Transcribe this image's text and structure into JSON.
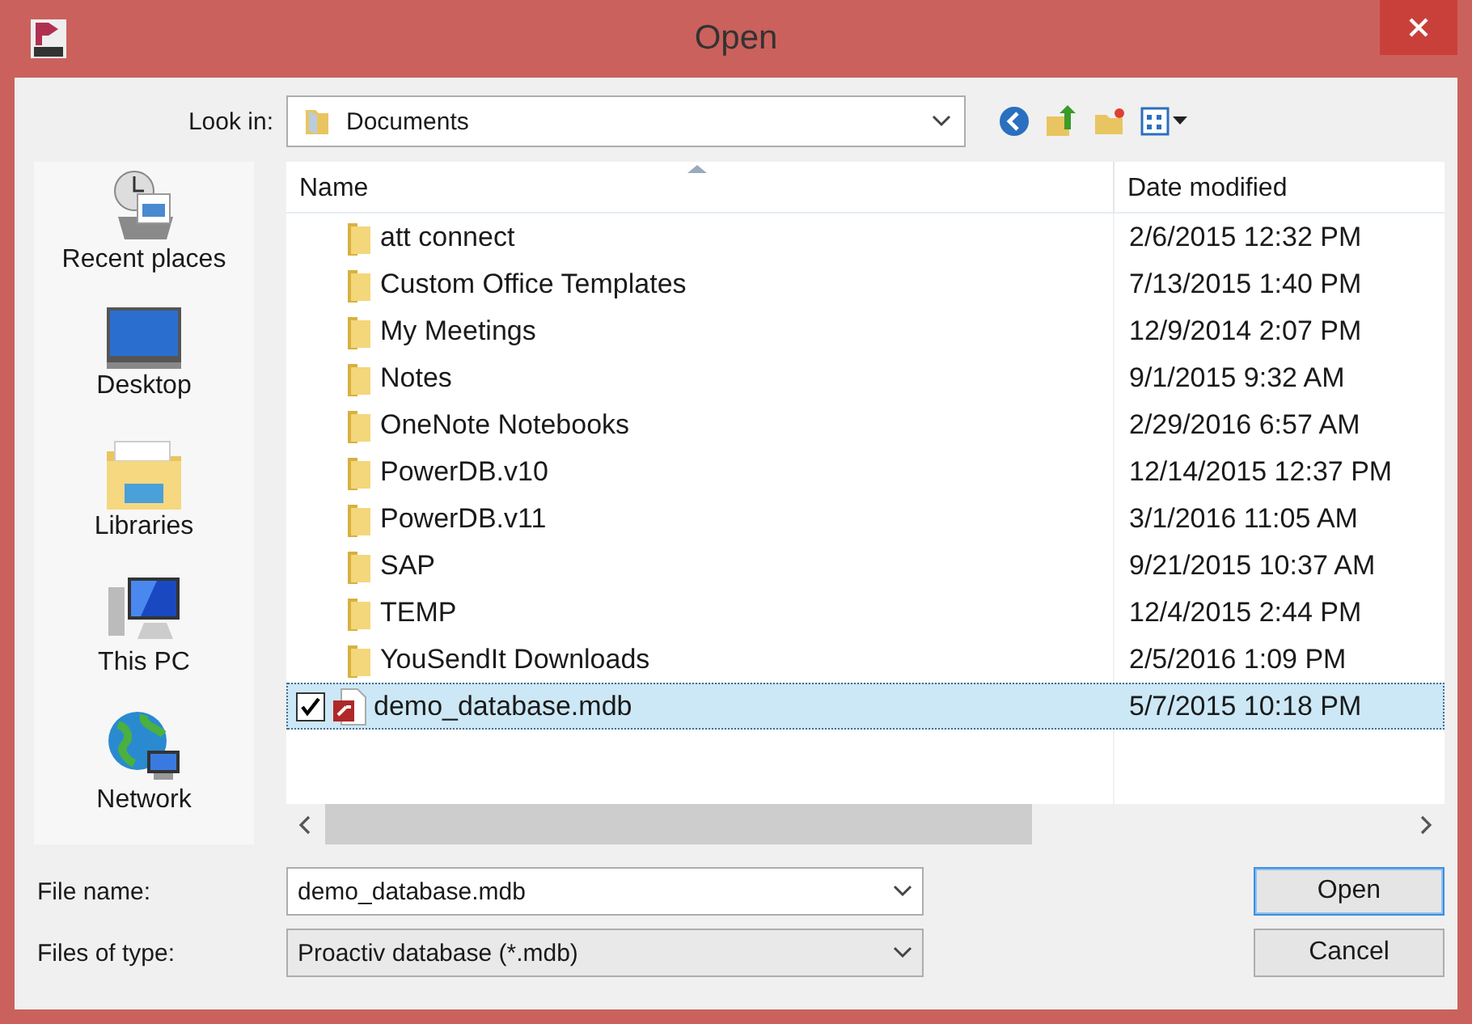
{
  "window": {
    "title": "Open"
  },
  "look_in": {
    "label": "Look in:",
    "value": "Documents"
  },
  "places": [
    {
      "label": "Recent places",
      "kind": "recent"
    },
    {
      "label": "Desktop",
      "kind": "desktop"
    },
    {
      "label": "Libraries",
      "kind": "libraries"
    },
    {
      "label": "This PC",
      "kind": "pc"
    },
    {
      "label": "Network",
      "kind": "network"
    }
  ],
  "table": {
    "columns": [
      "Name",
      "Date modified"
    ],
    "rows": [
      {
        "name": "att connect",
        "date": "2/6/2015 12:32 PM",
        "kind": "folder",
        "selected": false
      },
      {
        "name": "Custom Office Templates",
        "date": "7/13/2015 1:40 PM",
        "kind": "folder",
        "selected": false
      },
      {
        "name": "My Meetings",
        "date": "12/9/2014 2:07 PM",
        "kind": "folder",
        "selected": false
      },
      {
        "name": "Notes",
        "date": "9/1/2015 9:32 AM",
        "kind": "folder",
        "selected": false
      },
      {
        "name": "OneNote Notebooks",
        "date": "2/29/2016 6:57 AM",
        "kind": "folder",
        "selected": false
      },
      {
        "name": "PowerDB.v10",
        "date": "12/14/2015 12:37 PM",
        "kind": "folder",
        "selected": false
      },
      {
        "name": "PowerDB.v11",
        "date": "3/1/2016 11:05 AM",
        "kind": "folder",
        "selected": false
      },
      {
        "name": "SAP",
        "date": "9/21/2015 10:37 AM",
        "kind": "folder",
        "selected": false
      },
      {
        "name": "TEMP",
        "date": "12/4/2015 2:44 PM",
        "kind": "folder",
        "selected": false
      },
      {
        "name": "YouSendIt Downloads",
        "date": "2/5/2016 1:09 PM",
        "kind": "folder",
        "selected": false
      },
      {
        "name": "demo_database.mdb",
        "date": "5/7/2015 10:18 PM",
        "kind": "file",
        "selected": true,
        "checked": true
      }
    ]
  },
  "file_name": {
    "label": "File name:",
    "value": "demo_database.mdb"
  },
  "file_type": {
    "label": "Files of type:",
    "value": "Proactiv database (*.mdb)"
  },
  "buttons": [
    "Open",
    "Cancel"
  ]
}
